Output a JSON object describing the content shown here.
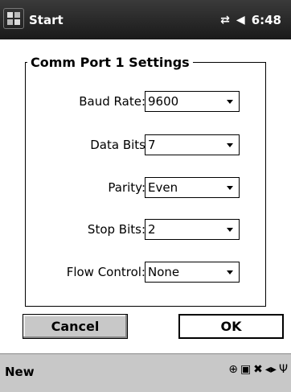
{
  "titlebar": {
    "app_title": "Start",
    "time": "6:48",
    "icons": [
      "windows-start-logo",
      "connectivity-icon",
      "speaker-icon"
    ]
  },
  "dialog": {
    "group_title": "Comm Port 1 Settings",
    "fields": [
      {
        "label": "Baud Rate:",
        "value": "9600"
      },
      {
        "label": "Data Bits",
        "value": "7"
      },
      {
        "label": "Parity:",
        "value": "Even"
      },
      {
        "label": "Stop Bits:",
        "value": "2"
      },
      {
        "label": "Flow Control:",
        "value": "None"
      }
    ],
    "cancel_label": "Cancel",
    "ok_label": "OK"
  },
  "cmdbar": {
    "new_label": "New",
    "tray_icons": [
      "globe-icon",
      "network-icon",
      "input-method-icon",
      "scroll-icon",
      "signal-icon"
    ]
  }
}
